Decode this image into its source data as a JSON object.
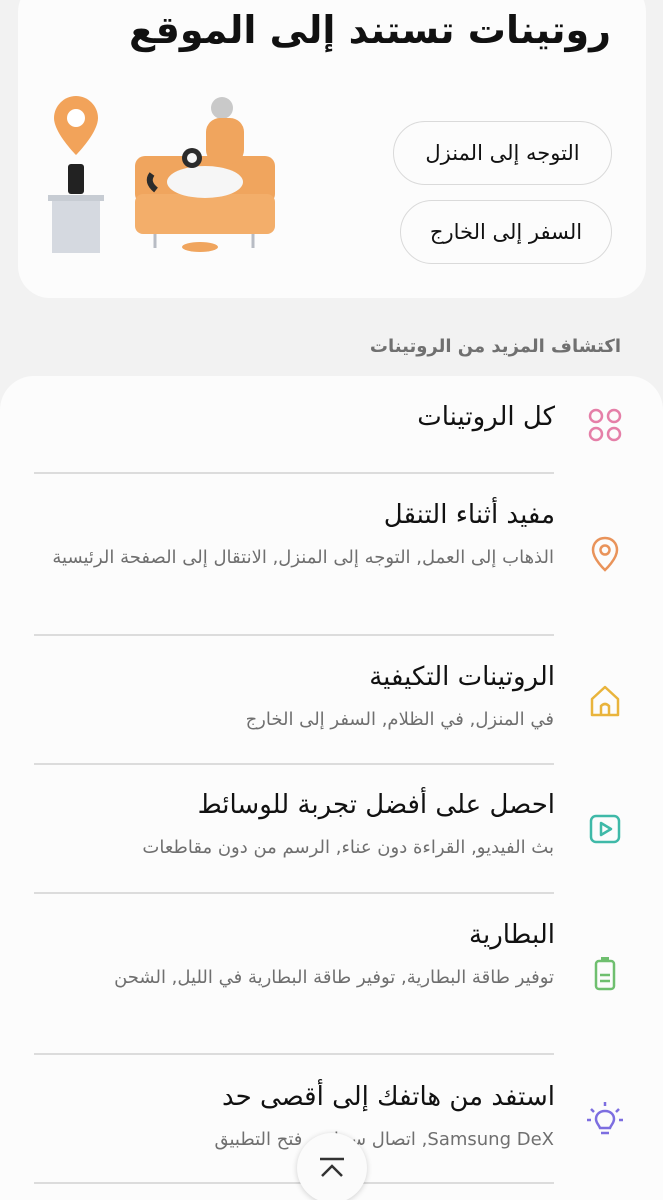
{
  "header": {
    "title": "روتينات تستند إلى الموقع",
    "chips": [
      "التوجه إلى المنزل",
      "السفر إلى الخارج"
    ]
  },
  "section_label": "اكتشاف المزيد من الروتينات",
  "routines": [
    {
      "title": "كل الروتينات",
      "subtitle": "",
      "icon": "grid-dots-icon",
      "color": "#e57fa8"
    },
    {
      "title": "مفيد أثناء التنقل",
      "subtitle": "الذهاب إلى العمل, التوجه إلى المنزل, الانتقال إلى الصفحة الرئيسية",
      "icon": "location-pin-icon",
      "color": "#e9935a"
    },
    {
      "title": "الروتينات التكيفية",
      "subtitle": "في المنزل, في الظلام, السفر إلى الخارج",
      "icon": "home-icon",
      "color": "#e9b43c"
    },
    {
      "title": "احصل على أفضل تجربة للوسائط",
      "subtitle": "بث الفيديو, القراءة دون عناء, الرسم من دون مقاطعات",
      "icon": "play-icon",
      "color": "#3fb9a8"
    },
    {
      "title": "البطارية",
      "subtitle": "توفير طاقة البطارية, توفير طاقة البطارية في الليل, الشحن",
      "icon": "battery-icon",
      "color": "#6fbf6f"
    },
    {
      "title": "استفد من هاتفك إلى أقصى حد",
      "subtitle": "Samsung DeX, اتصال سحابي, فتح التطبيق",
      "icon": "lightbulb-icon",
      "color": "#7d6ee0"
    }
  ],
  "colors": {
    "accent_orange": "#f2a35a",
    "background": "#f2f2f2",
    "card": "#fcfcfc"
  }
}
